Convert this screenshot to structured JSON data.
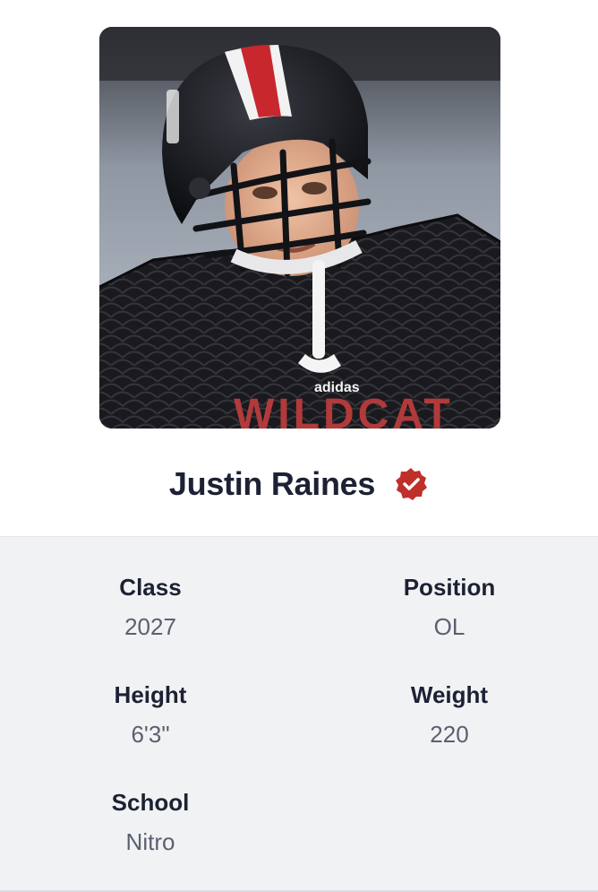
{
  "profile": {
    "name": "Justin Raines",
    "photo_alt": "player-photo",
    "jersey_text": "WILDCAT",
    "mouthguard_brand": "adidas",
    "verified_icon": "verified-badge-icon",
    "verified_color": "#c0302b"
  },
  "stats": {
    "class_label": "Class",
    "class_value": "2027",
    "position_label": "Position",
    "position_value": "OL",
    "height_label": "Height",
    "height_value": "6'3\"",
    "weight_label": "Weight",
    "weight_value": "220",
    "school_label": "School",
    "school_value": "Nitro"
  },
  "colors": {
    "text_dark": "#1c2233",
    "text_muted": "#5a606e",
    "panel_bg": "#f1f2f4"
  }
}
